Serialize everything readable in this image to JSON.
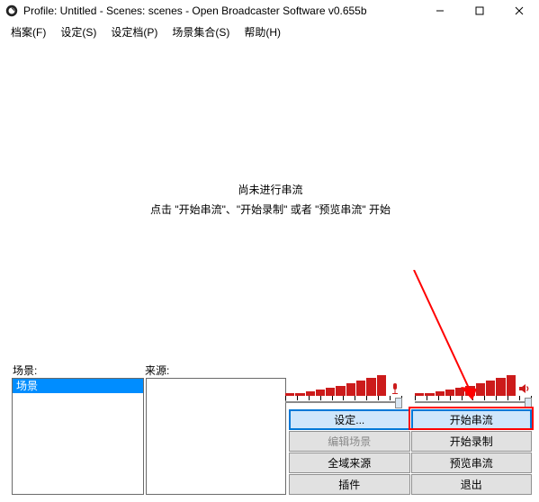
{
  "window": {
    "title": "Profile: Untitled - Scenes: scenes - Open Broadcaster Software v0.655b"
  },
  "menu": {
    "file": "档案(F)",
    "settings": "设定(S)",
    "profile": "设定档(P)",
    "scene_coll": "场景集合(S)",
    "help": "帮助(H)"
  },
  "canvas": {
    "line1": "尚未进行串流",
    "line2": "点击 \"开始串流\"、\"开始录制\" 或者 \"预览串流\" 开始"
  },
  "labels": {
    "scenes": "场景:",
    "sources": "来源:"
  },
  "scene_list": {
    "item0": "场景"
  },
  "buttons": {
    "settings": "设定...",
    "start_stream": "开始串流",
    "edit_scene": "编辑场景",
    "start_record": "开始录制",
    "global_src": "全域来源",
    "preview_stream": "预览串流",
    "plugins": "插件",
    "exit": "退出"
  }
}
